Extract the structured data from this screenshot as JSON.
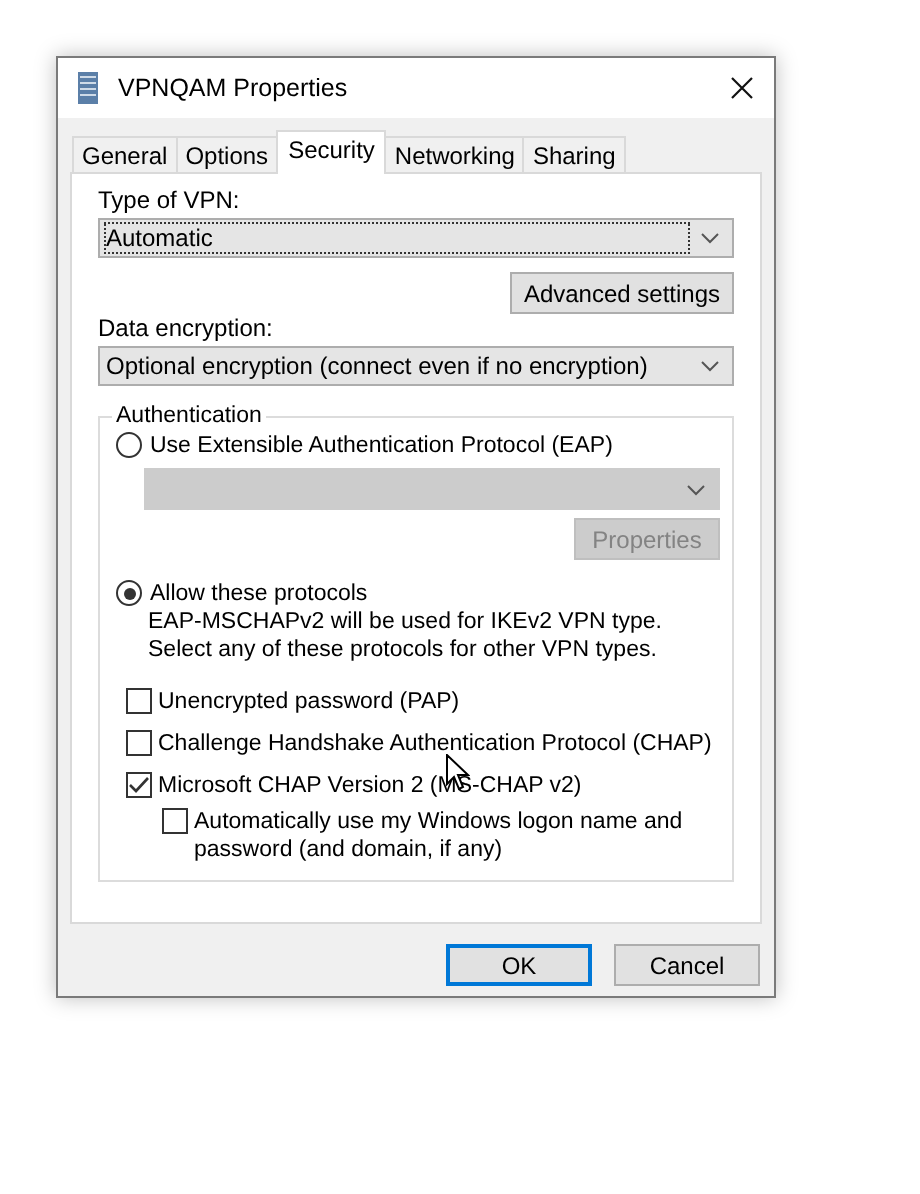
{
  "window": {
    "title": "VPNQAM Properties"
  },
  "tabs": [
    {
      "label": "General",
      "selected": false
    },
    {
      "label": "Options",
      "selected": false
    },
    {
      "label": "Security",
      "selected": true
    },
    {
      "label": "Networking",
      "selected": false
    },
    {
      "label": "Sharing",
      "selected": false
    }
  ],
  "type_of_vpn": {
    "label": "Type of VPN:",
    "value": "Automatic"
  },
  "advanced_button": "Advanced settings",
  "data_encryption": {
    "label": "Data encryption:",
    "value": "Optional encryption (connect even if no encryption)"
  },
  "authentication": {
    "title": "Authentication",
    "eap": {
      "label": "Use Extensible Authentication Protocol (EAP)",
      "selected": false,
      "dropdown_disabled": true,
      "properties_button": {
        "label": "Properties",
        "disabled": true
      }
    },
    "protocols": {
      "label": "Allow these protocols",
      "selected": true,
      "note": "EAP-MSCHAPv2 will be used for IKEv2 VPN type. Select any of these protocols for other VPN types.",
      "checkboxes": [
        {
          "label": "Unencrypted password (PAP)",
          "checked": false
        },
        {
          "label": "Challenge Handshake Authentication Protocol (CHAP)",
          "checked": false
        },
        {
          "label": "Microsoft CHAP Version 2 (MS-CHAP v2)",
          "checked": true,
          "children": [
            {
              "label": "Automatically use my Windows logon name and password (and domain, if any)",
              "checked": false
            }
          ]
        }
      ]
    }
  },
  "buttons": [
    {
      "label": "OK",
      "kind": "default"
    },
    {
      "label": "Cancel",
      "kind": "normal"
    }
  ]
}
